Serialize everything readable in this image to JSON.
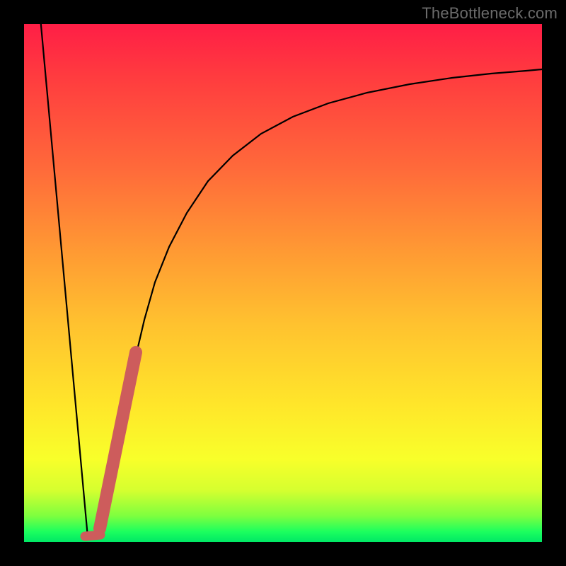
{
  "watermark": "TheBottleneck.com",
  "colors": {
    "frame": "#000000",
    "curve": "#000000",
    "highlight_fill": "#cd5c5c",
    "highlight_stroke": "#cd5c5c",
    "gradient_top": "#ff1e46",
    "gradient_bottom": "#00e865"
  },
  "chart_data": {
    "type": "line",
    "title": "",
    "xlabel": "",
    "ylabel": "",
    "xlim": [
      0,
      100
    ],
    "ylim": [
      0,
      100
    ],
    "series": [
      {
        "name": "left-steep-line",
        "x": [
          3,
          12
        ],
        "y": [
          100,
          0
        ]
      },
      {
        "name": "bottleneck-curve",
        "x": [
          14,
          16,
          18,
          20,
          22,
          24,
          26,
          30,
          35,
          40,
          45,
          50,
          55,
          60,
          65,
          70,
          75,
          80,
          85,
          90,
          95,
          100
        ],
        "y": [
          2,
          10,
          20,
          30,
          40,
          48,
          54,
          62,
          69,
          74,
          78,
          81,
          83.5,
          85.5,
          87,
          88.3,
          89.3,
          90.1,
          90.8,
          91.4,
          91.9,
          92.3
        ]
      }
    ],
    "annotations": [
      {
        "name": "highlight-segment",
        "shape": "rounded-bar",
        "x_range": [
          14,
          21.5
        ],
        "y_range": [
          2,
          37
        ]
      },
      {
        "name": "minimum-marker",
        "shape": "rounded-bar",
        "x_range": [
          11.5,
          14.5
        ],
        "y_range": [
          0.5,
          2
        ]
      }
    ]
  }
}
